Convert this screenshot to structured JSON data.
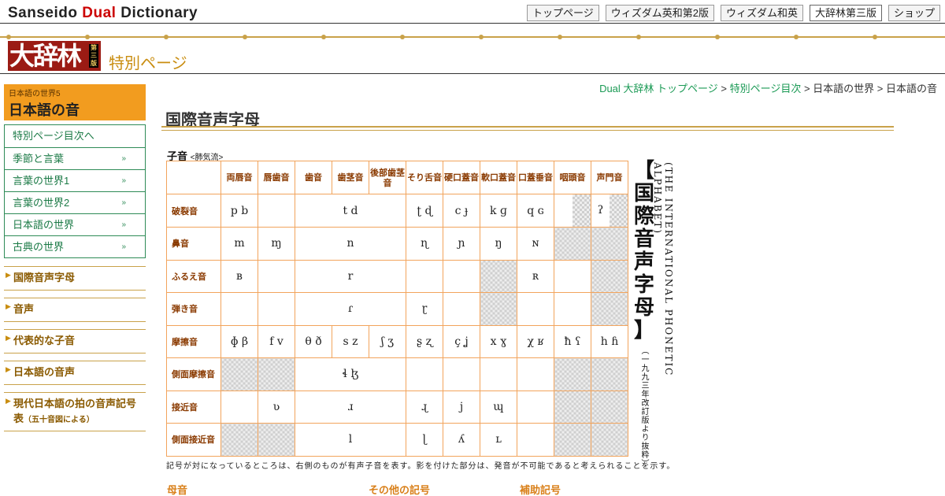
{
  "header": {
    "brand_part1": "Sanseido ",
    "brand_part2": "Dual",
    "brand_part3": " Dictionary",
    "nav": [
      "トップページ",
      "ウィズダム英和第2版",
      "ウィズダム和英",
      "大辞林第三版",
      "ショップ"
    ],
    "active_nav": "大辞林第三版"
  },
  "banner": {
    "logo_text": "大辞林",
    "logo_edition": "第三版",
    "special_label": "特別ページ"
  },
  "sidebar": {
    "head_sub": "日本語の世界5",
    "head_main": "日本語の音",
    "items": [
      {
        "label": "特別ページ目次へ",
        "chev": ""
      },
      {
        "label": "季節と言葉",
        "chev": "»"
      },
      {
        "label": "言葉の世界1",
        "chev": "»"
      },
      {
        "label": "言葉の世界2",
        "chev": "»"
      },
      {
        "label": "日本語の世界",
        "chev": "»"
      },
      {
        "label": "古典の世界",
        "chev": "»"
      }
    ],
    "links": [
      {
        "label": "国際音声字母",
        "small": ""
      },
      {
        "label": "音声",
        "small": ""
      },
      {
        "label": "代表的な子音",
        "small": ""
      },
      {
        "label": "日本語の音声",
        "small": ""
      },
      {
        "label": "現代日本語の拍の音声記号表",
        "small": "（五十音図による）"
      }
    ]
  },
  "breadcrumb": {
    "links": [
      "Dual 大辞林 トップページ",
      "特別ページ目次"
    ],
    "sep": " > ",
    "rest": "日本語の世界 > 日本語の音"
  },
  "page_title": "国際音声字母",
  "section_label": "子音",
  "section_note": "<肺気流>",
  "table": {
    "col_headers": [
      "両唇音",
      "唇歯音",
      "歯音",
      "歯茎音",
      "後部歯茎音",
      "そり舌音",
      "硬口蓋音",
      "軟口蓋音",
      "口蓋垂音",
      "咽頭音",
      "声門音"
    ],
    "rows": [
      {
        "label": "破裂音",
        "cells": [
          "p  b",
          "",
          "t  d",
          "ʈ  ɖ",
          "c  ɟ",
          "k  ɡ",
          "q  ɢ",
          "",
          "ʔ"
        ]
      },
      {
        "label": "鼻音",
        "cells": [
          "m",
          "ɱ",
          "n",
          "ɳ",
          "ɲ",
          "ŋ",
          "ɴ",
          "",
          ""
        ]
      },
      {
        "label": "ふるえ音",
        "cells": [
          "ʙ",
          "",
          "r",
          "",
          "",
          "",
          "ʀ",
          "",
          ""
        ]
      },
      {
        "label": "弾き音",
        "cells": [
          "",
          "",
          "ɾ",
          "ɽ",
          "",
          "",
          "",
          "",
          ""
        ]
      },
      {
        "label": "摩擦音",
        "cells": [
          "ɸ  β",
          "f  v",
          "θ  ð",
          "s  z",
          "ʃ  ʒ",
          "ʂ  ʐ",
          "ç  ʝ",
          "x  ɣ",
          "χ  ʁ",
          "ħ  ʕ",
          "h  ɦ"
        ]
      },
      {
        "label": "側面摩擦音",
        "cells": [
          "",
          "",
          "ɬ  ɮ",
          "",
          "",
          "",
          "",
          "",
          ""
        ]
      },
      {
        "label": "接近音",
        "cells": [
          "",
          "ʋ",
          "ɹ",
          "ɻ",
          "j",
          "ɰ",
          "",
          "",
          ""
        ]
      },
      {
        "label": "側面接近音",
        "cells": [
          "",
          "",
          "l",
          "ɭ",
          "ʎ",
          "ʟ",
          "",
          "",
          ""
        ]
      }
    ]
  },
  "vertical_title": "【国際音声字母】",
  "vertical_english": "(THE INTERNATIONAL PHONETIC ALPHABET)",
  "vertical_note": "（一九九三年改訂版より抜粋）",
  "footnote": "記号が対になっているところは、右側のものが有声子音を表す。影を付けた部分は、発音が不可能であると考えられることを示す。",
  "subsections": [
    "母音",
    "その他の記号",
    "補助記号"
  ]
}
